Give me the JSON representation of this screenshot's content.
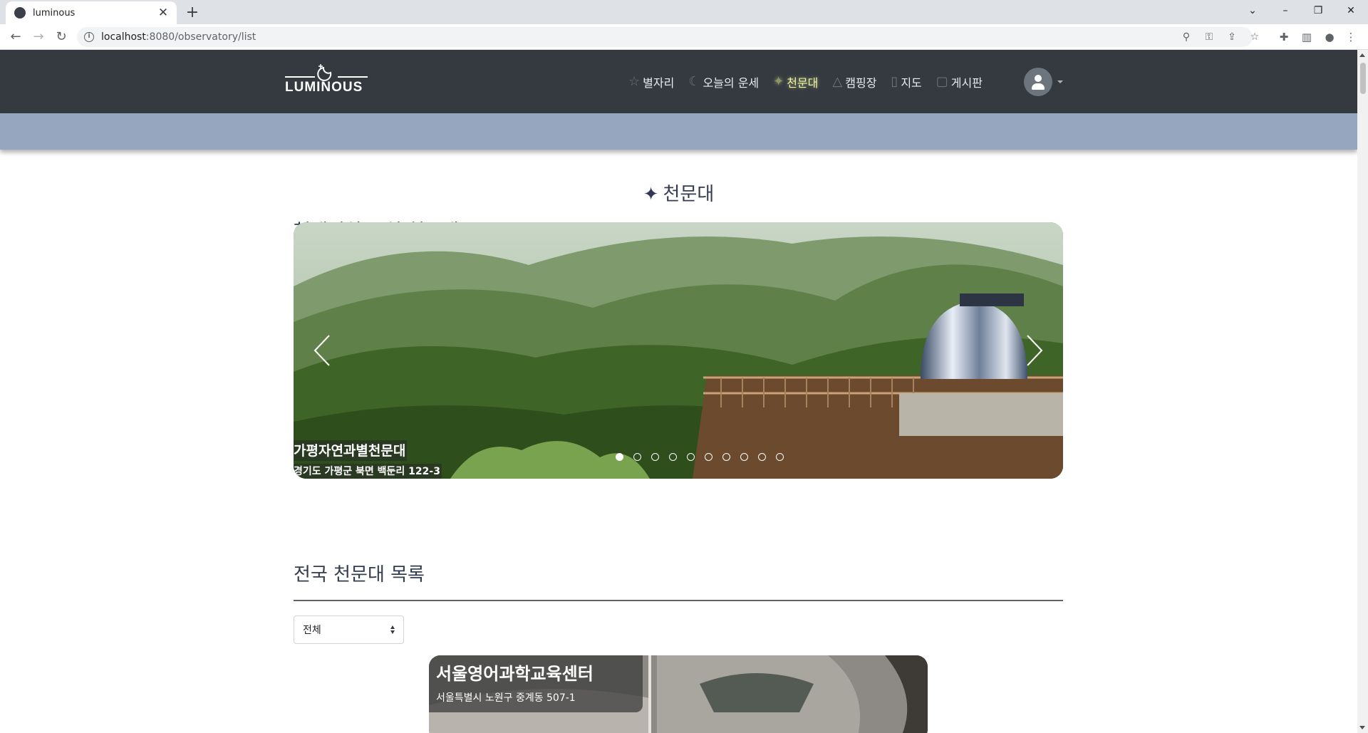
{
  "browser": {
    "tab_title": "luminous",
    "url_host": "localhost",
    "url_rest": ":8080/observatory/list"
  },
  "site": {
    "logo_text": "LUMINOUS",
    "menu": [
      {
        "label": "별자리",
        "icon": "star-icon"
      },
      {
        "label": "오늘의 운세",
        "icon": "moon-icon"
      },
      {
        "label": "천문대",
        "icon": "sparkle-icon",
        "active": true
      },
      {
        "label": "캠핑장",
        "icon": "tent-icon"
      },
      {
        "label": "지도",
        "icon": "map-icon"
      },
      {
        "label": "게시판",
        "icon": "clipboard-icon"
      }
    ]
  },
  "page": {
    "title": "천문대",
    "nearby_heading": "현재위치 근처 천문대",
    "list_heading": "전국 천문대 목록"
  },
  "carousel": {
    "title": "가평자연과별천문대",
    "address": "경기도 가평군 북면 백둔리 122-3",
    "active_index": 0,
    "count": 10
  },
  "filter": {
    "selected": "전체"
  },
  "card": {
    "title": "서울영어과학교육센터",
    "address": "서울특별시 노원구 중계동 507-1"
  },
  "colors": {
    "nav_bg": "#343a40",
    "subbar_bg": "#97a6bf",
    "active_menu": "#f1f5a0"
  }
}
